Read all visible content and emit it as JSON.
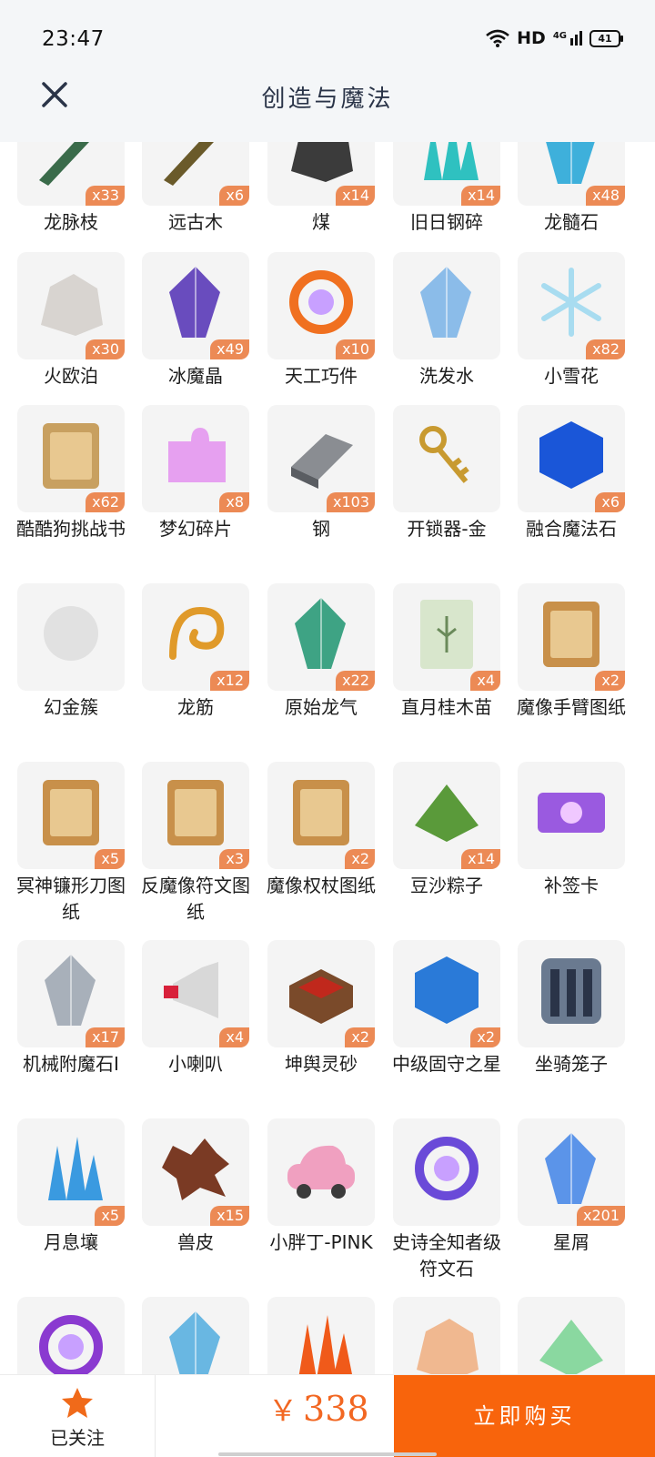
{
  "status": {
    "time": "23:47",
    "network": "HD",
    "cell": "4G",
    "battery": "41"
  },
  "header": {
    "title": "创造与魔法"
  },
  "items": [
    {
      "name": "龙脉枝",
      "qty": "x33",
      "icon": "dragon-vein-branch-icon",
      "color": "#3a6b4a"
    },
    {
      "name": "远古木",
      "qty": "x6",
      "icon": "ancient-wood-icon",
      "color": "#6a5a2a"
    },
    {
      "name": "煤",
      "qty": "x14",
      "icon": "coal-icon",
      "color": "#3b3b3b"
    },
    {
      "name": "旧日钢碎",
      "qty": "x14",
      "icon": "old-steel-shard-icon",
      "color": "#2fc1c0"
    },
    {
      "name": "龙髓石",
      "qty": "x48",
      "icon": "dragon-marrow-stone-icon",
      "color": "#2aa8d8"
    },
    {
      "name": "火欧泊",
      "qty": "x30",
      "icon": "fire-opal-icon",
      "color": "#d8d4d0"
    },
    {
      "name": "冰魔晶",
      "qty": "x49",
      "icon": "ice-magic-crystal-icon",
      "color": "#5a3ab8"
    },
    {
      "name": "天工巧件",
      "qty": "x10",
      "icon": "gear-part-icon",
      "color": "#f07020"
    },
    {
      "name": "洗发水",
      "qty": "",
      "icon": "shampoo-bottle-icon",
      "color": "#7fb6e8"
    },
    {
      "name": "小雪花",
      "qty": "x82",
      "icon": "snowflake-icon",
      "color": "#a8dcf0"
    },
    {
      "name": "酷酷狗挑战书",
      "qty": "x62",
      "icon": "wanted-scroll-icon",
      "color": "#c8a060"
    },
    {
      "name": "梦幻碎片",
      "qty": "x8",
      "icon": "puzzle-piece-icon",
      "color": "#e6a0f0"
    },
    {
      "name": "钢",
      "qty": "x103",
      "icon": "steel-ingot-icon",
      "color": "#8a8d92"
    },
    {
      "name": "开锁器-金",
      "qty": "",
      "icon": "gold-keys-icon",
      "color": "#c89a30"
    },
    {
      "name": "融合魔法石",
      "qty": "x6",
      "icon": "fusion-magic-stone-icon",
      "color": "#1a56d8"
    },
    {
      "name": "幻金簇",
      "qty": "",
      "icon": "phantom-gold-cluster-icon",
      "color": "#d4d4d4"
    },
    {
      "name": "龙筋",
      "qty": "x12",
      "icon": "dragon-tendon-icon",
      "color": "#e09a2a"
    },
    {
      "name": "原始龙气",
      "qty": "x22",
      "icon": "primal-dragon-qi-icon",
      "color": "#2a9a78"
    },
    {
      "name": "直月桂木苗",
      "qty": "x4",
      "icon": "seed-packet-icon",
      "color": "#d8e6cc"
    },
    {
      "name": "魔像手臂图纸",
      "qty": "x2",
      "icon": "golem-arm-blueprint-icon",
      "color": "#c8904a"
    },
    {
      "name": "冥神镰形刀图纸",
      "qty": "x5",
      "icon": "scythe-blueprint-icon",
      "color": "#c8904a"
    },
    {
      "name": "反魔像符文图纸",
      "qty": "x3",
      "icon": "rune-blueprint-icon",
      "color": "#c8904a"
    },
    {
      "name": "魔像权杖图纸",
      "qty": "x2",
      "icon": "scepter-blueprint-icon",
      "color": "#c8904a"
    },
    {
      "name": "豆沙粽子",
      "qty": "x14",
      "icon": "zongzi-icon",
      "color": "#5a9a3a"
    },
    {
      "name": "补签卡",
      "qty": "",
      "icon": "sign-in-card-icon",
      "color": "#9a5ae0"
    },
    {
      "name": "机械附魔石Ⅰ",
      "qty": "x17",
      "icon": "mech-enchant-stone-icon",
      "color": "#a0a8b4"
    },
    {
      "name": "小喇叭",
      "qty": "x4",
      "icon": "megaphone-icon",
      "color": "#d8d8d8"
    },
    {
      "name": "坤舆灵砂",
      "qty": "x2",
      "icon": "spirit-sand-box-icon",
      "color": "#c0281c"
    },
    {
      "name": "中级固守之星",
      "qty": "x2",
      "icon": "guardian-star-icon",
      "color": "#2a7ad8"
    },
    {
      "name": "坐骑笼子",
      "qty": "",
      "icon": "mount-cage-icon",
      "color": "#6a7a90"
    },
    {
      "name": "月息壤",
      "qty": "x5",
      "icon": "moon-soil-icon",
      "color": "#3a9ae0"
    },
    {
      "name": "兽皮",
      "qty": "x15",
      "icon": "animal-hide-icon",
      "color": "#7a3a24"
    },
    {
      "name": "小胖丁-PINK",
      "qty": "",
      "icon": "pink-car-icon",
      "color": "#f0a0c0"
    },
    {
      "name": "史诗全知者级符文石",
      "qty": "",
      "icon": "epic-rune-stone-icon",
      "color": "#6a4ad8"
    },
    {
      "name": "星屑",
      "qty": "x201",
      "icon": "stardust-icon",
      "color": "#4a8ae8"
    },
    {
      "name": "",
      "qty": "",
      "icon": "purple-cauldron-icon",
      "color": "#8a3ad0"
    },
    {
      "name": "",
      "qty": "",
      "icon": "blue-figure-icon",
      "color": "#5ab0e0"
    },
    {
      "name": "",
      "qty": "",
      "icon": "fire-crystal-icon",
      "color": "#f05a1a"
    },
    {
      "name": "",
      "qty": "",
      "icon": "peach-item-icon",
      "color": "#f0b890"
    },
    {
      "name": "",
      "qty": "",
      "icon": "sprout-icon",
      "color": "#8ad8a0"
    }
  ],
  "footer": {
    "follow_label": "已关注",
    "currency": "￥",
    "price": "338",
    "buy_label": "立即购买"
  },
  "colors": {
    "accent": "#f8640c",
    "badge": "#ec8a55",
    "price": "#f26722",
    "star": "#f06a1a"
  }
}
